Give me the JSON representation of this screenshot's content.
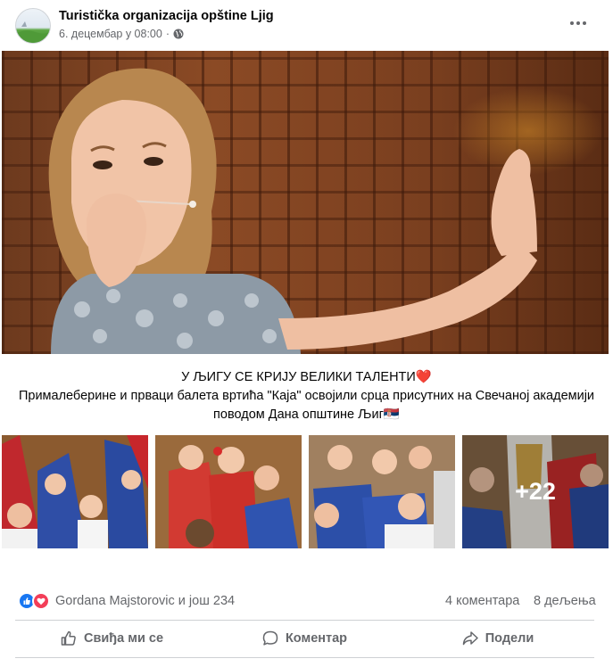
{
  "post": {
    "page_name": "Turistička organizacija opštine Ljig",
    "timestamp": "6. децембар у 08:00",
    "audience_icon": "globe-icon",
    "menu_icon": "more-options-icon"
  },
  "caption": {
    "line1": "У ЉИГУ СЕ КРИЈУ ВЕЛИКИ ТАЛЕНТИ",
    "line1_emoji": "❤️",
    "line2": "Прималеберине и прваци балета вртића \"Каја\" освојили срца присутних на Свечаној академији поводом Дана општине Љиг",
    "line2_emoji": "🇷🇸"
  },
  "gallery": {
    "more_count": "+22"
  },
  "reactions": {
    "icons": [
      "like-icon",
      "love-icon"
    ],
    "summary": "Gordana Majstorovic и још 234",
    "comments": "4 коментара",
    "shares": "8 дељења"
  },
  "actions": {
    "like": "Свиђа ми се",
    "comment": "Коментар",
    "share": "Подели"
  },
  "colors": {
    "like_blue": "#1877f2",
    "love_red": "#f33e58",
    "secondary_text": "#65676b",
    "divider": "#ced0d4"
  }
}
